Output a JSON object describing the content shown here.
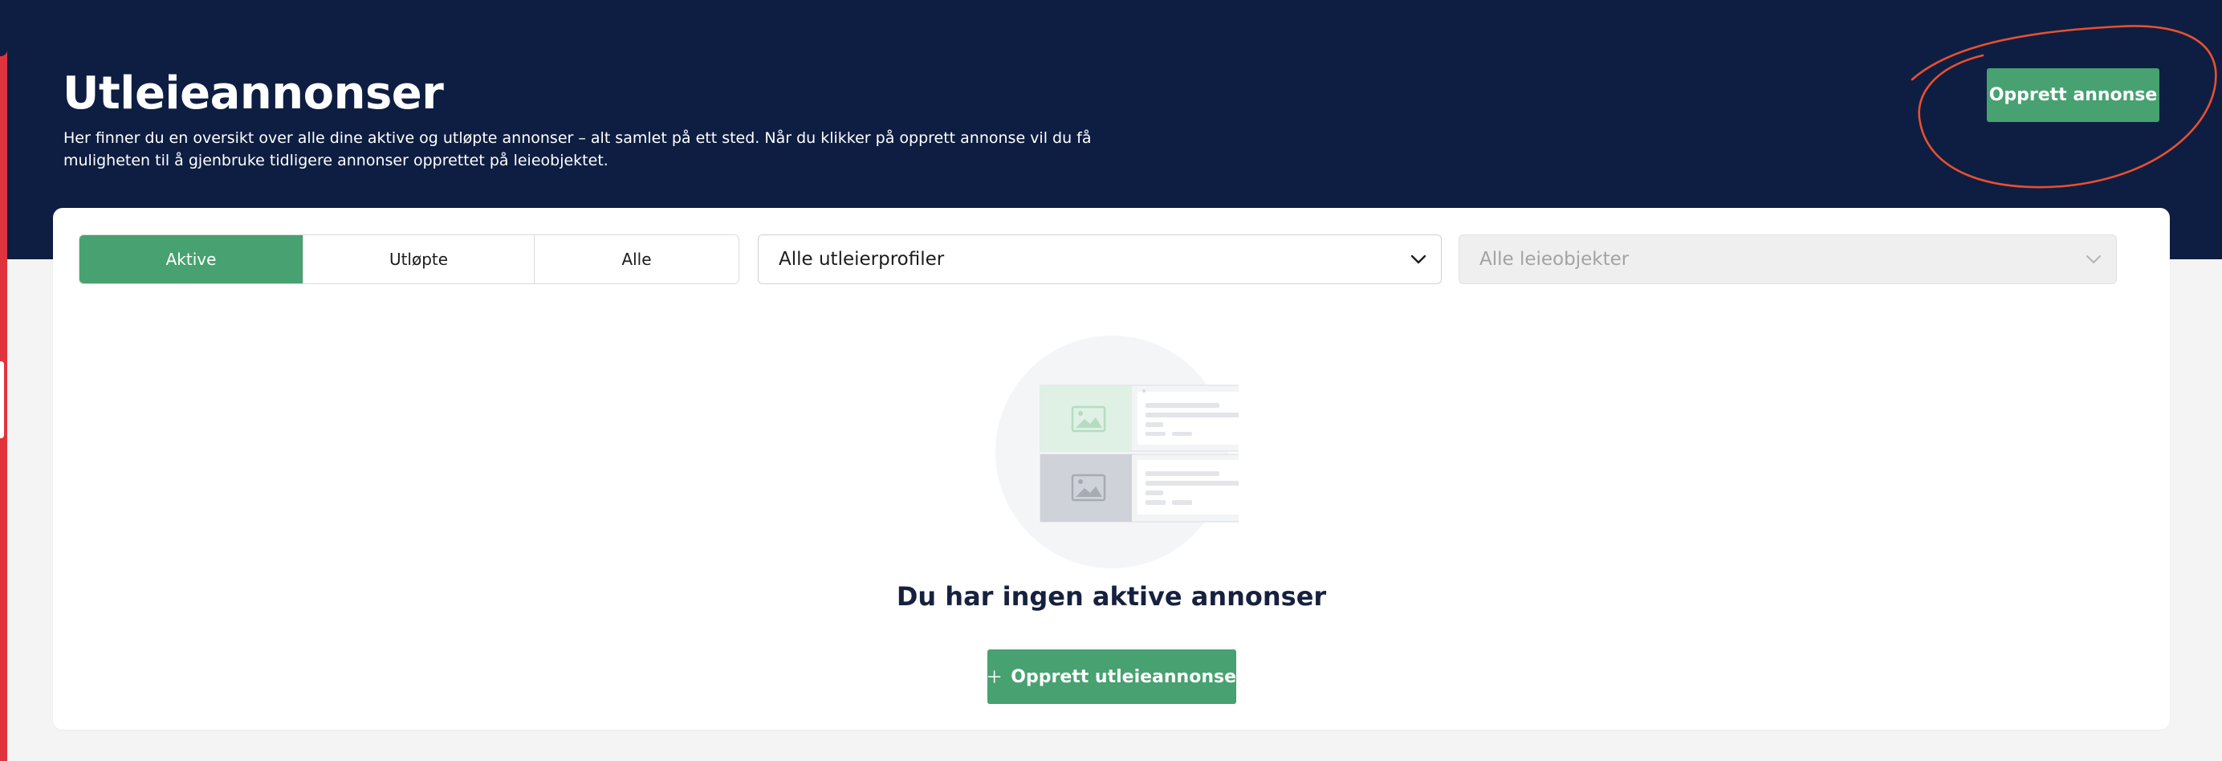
{
  "header": {
    "title": "Utleieannonser",
    "description": "Her finner du en oversikt over alle dine aktive og utløpte annonser – alt samlet på ett sted. Når du klikker på opprett annonse vil du få muligheten til å gjenbruke tidligere annonser opprettet på leieobjektet.",
    "create_button_label": "Opprett annonse"
  },
  "filters": {
    "status_tabs": [
      {
        "label": "Aktive",
        "active": true
      },
      {
        "label": "Utløpte",
        "active": false
      },
      {
        "label": "Alle",
        "active": false
      }
    ],
    "landlord_profile_select": {
      "value": "Alle utleierprofiler"
    },
    "rental_object_select": {
      "value": "Alle leieobjekter",
      "disabled": true
    }
  },
  "empty_state": {
    "illustration_icon": "listing-cards-illustration",
    "title": "Du har ingen aktive annonser",
    "cta_label": "Opprett utleieannonse",
    "cta_icon": "plus-icon"
  },
  "colors": {
    "header_bg": "#0e1e42",
    "accent_green": "#47a170",
    "page_bg": "#f4f4f4",
    "annotation_red": "#e8502f",
    "side_strip_red": "#e0343d"
  }
}
